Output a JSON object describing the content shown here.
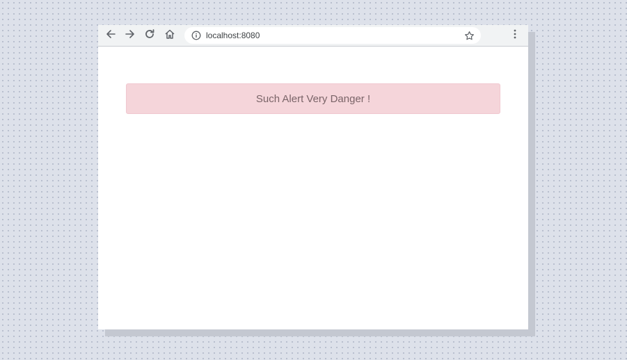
{
  "browser": {
    "url": "localhost:8080",
    "icons": {
      "back": "arrow-left-icon",
      "forward": "arrow-right-icon",
      "reload": "reload-icon",
      "home": "home-icon",
      "site_info": "info-icon",
      "bookmark": "star-icon",
      "menu": "more-vertical-icon"
    }
  },
  "page": {
    "alert": {
      "text": "Such Alert Very Danger !",
      "variant": "danger",
      "background": "#f5d5da",
      "text_color": "#7a6468"
    }
  },
  "colors": {
    "desktop_background": "#dde1ea",
    "toolbar_background": "#f1f3f4",
    "window_background": "#ffffff"
  }
}
